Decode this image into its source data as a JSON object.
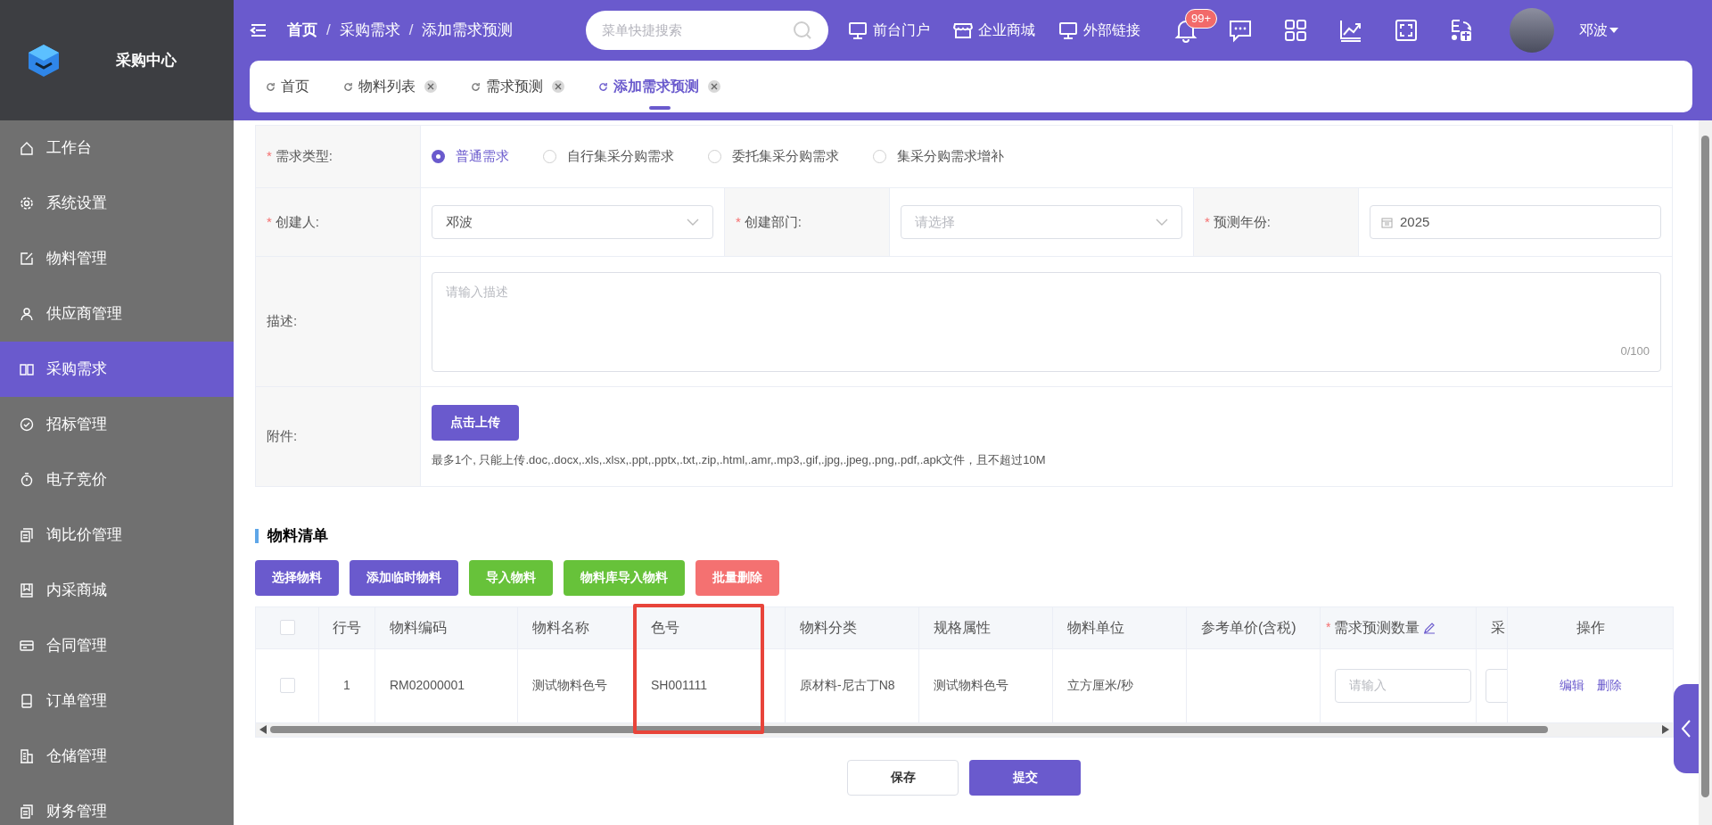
{
  "app": {
    "title": "采购中心"
  },
  "sidebar": {
    "items": [
      {
        "label": "工作台",
        "selected": false
      },
      {
        "label": "系统设置",
        "selected": false
      },
      {
        "label": "物料管理",
        "selected": false
      },
      {
        "label": "供应商管理",
        "selected": false
      },
      {
        "label": "采购需求",
        "selected": true
      },
      {
        "label": "招标管理",
        "selected": false
      },
      {
        "label": "电子竞价",
        "selected": false
      },
      {
        "label": "询比价管理",
        "selected": false
      },
      {
        "label": "内采商城",
        "selected": false
      },
      {
        "label": "合同管理",
        "selected": false
      },
      {
        "label": "订单管理",
        "selected": false
      },
      {
        "label": "仓储管理",
        "selected": false
      },
      {
        "label": "财务管理",
        "selected": false
      }
    ]
  },
  "header": {
    "breadcrumb": [
      {
        "kind": "item",
        "text": "首页"
      },
      {
        "kind": "separator",
        "text": "/"
      },
      {
        "kind": "item",
        "text": "采购需求"
      },
      {
        "kind": "separator",
        "text": "/"
      },
      {
        "kind": "item",
        "text": "添加需求预测"
      }
    ],
    "search": {
      "placeholder": "菜单快捷搜索"
    },
    "links": [
      {
        "label": "前台门户"
      },
      {
        "label": "企业商城"
      },
      {
        "label": "外部链接"
      }
    ],
    "notification_badge": "99+",
    "user": "邓波"
  },
  "tabs": [
    {
      "label": "首页",
      "selected": false,
      "closable": false
    },
    {
      "label": "物料列表",
      "selected": false,
      "closable": true
    },
    {
      "label": "需求预测",
      "selected": false,
      "closable": true
    },
    {
      "label": "添加需求预测",
      "selected": true,
      "closable": true
    }
  ],
  "form": {
    "demand_type": {
      "label": "需求类型:",
      "required_mark": "*",
      "options": [
        {
          "label": "普通需求",
          "selected": true
        },
        {
          "label": "自行集采分购需求",
          "selected": false
        },
        {
          "label": "委托集采分购需求",
          "selected": false
        },
        {
          "label": "集采分购需求增补",
          "selected": false
        }
      ]
    },
    "creator": {
      "label": "创建人:",
      "required_mark": "*",
      "value": "邓波"
    },
    "department": {
      "label": "创建部门:",
      "required_mark": "*",
      "placeholder": "请选择"
    },
    "year": {
      "label": "预测年份:",
      "required_mark": "*",
      "value": "2025"
    },
    "description": {
      "label": "描述:",
      "placeholder": "请输入描述",
      "counter": "0/100"
    },
    "attachment": {
      "label": "附件:",
      "button": "点击上传",
      "hint": "最多1个, 只能上传.doc,.docx,.xls,.xlsx,.ppt,.pptx,.txt,.zip,.html,.amr,.mp3,.gif,.jpg,.jpeg,.png,.pdf,.apk文件，且不超过10M"
    }
  },
  "materials": {
    "title": "物料清单",
    "buttons": [
      {
        "label": "选择物料",
        "kind": "primary"
      },
      {
        "label": "添加临时物料",
        "kind": "primary"
      },
      {
        "label": "导入物料",
        "kind": "success"
      },
      {
        "label": "物料库导入物料",
        "kind": "success"
      },
      {
        "label": "批量删除",
        "kind": "danger"
      }
    ],
    "table": {
      "select_all_checked": false,
      "columns": [
        {
          "label": "行号",
          "highlighted": false
        },
        {
          "label": "物料编码",
          "highlighted": false
        },
        {
          "label": "物料名称",
          "highlighted": false
        },
        {
          "label": "色号",
          "highlighted": true
        },
        {
          "label": "物料分类",
          "highlighted": false
        },
        {
          "label": "规格属性",
          "highlighted": false
        },
        {
          "label": "物料单位",
          "highlighted": false
        },
        {
          "label": "参考单价(含税)",
          "highlighted": false
        },
        {
          "label": "需求预测数量",
          "highlighted": false,
          "required_mark": "*",
          "editable": true
        },
        {
          "label": "采",
          "highlighted": false
        },
        {
          "label": "操作",
          "highlighted": false
        }
      ],
      "rows": [
        {
          "checked": false,
          "cells": [
            "1",
            "RM02000001",
            "测试物料色号",
            "SH001111",
            "原材料-尼古丁N8",
            "测试物料色号",
            "立方厘米/秒",
            ""
          ],
          "quantity_placeholder": "请输入",
          "actions": [
            "编辑",
            "删除"
          ]
        }
      ]
    }
  },
  "footer_buttons": [
    {
      "label": "保存",
      "kind": "default"
    },
    {
      "label": "提交",
      "kind": "primary"
    }
  ]
}
